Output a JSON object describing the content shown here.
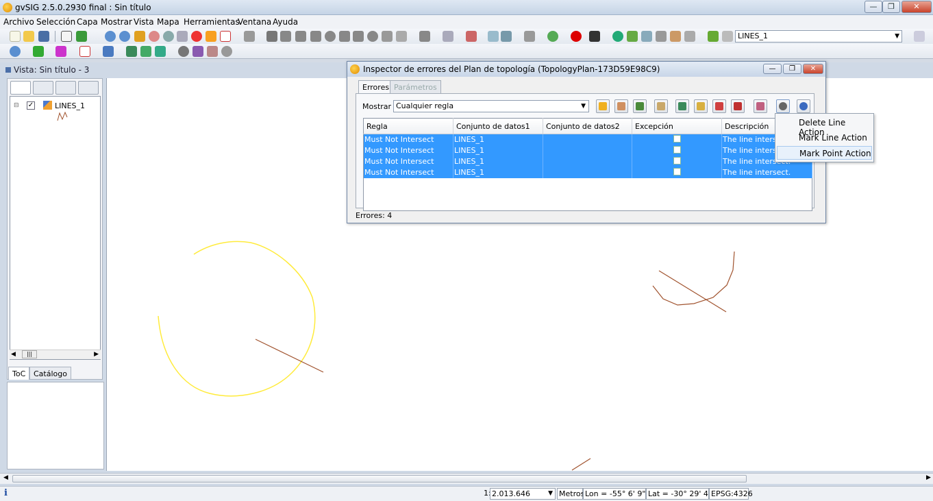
{
  "window": {
    "title": "gvSIG 2.5.0.2930 final : Sin título",
    "minimize_label": "—",
    "maximize_label": "❐",
    "close_label": "✕"
  },
  "menubar": [
    "Archivo",
    "Selección",
    "Capa",
    "Mostrar",
    "Vista",
    "Mapa",
    "Herramientas",
    "Ventana",
    "Ayuda"
  ],
  "toolbar": {
    "layer_select_value": "LINES_1"
  },
  "view": {
    "title": "Vista: Sin título - 3",
    "toc": {
      "layer_name": "LINES_1",
      "layer_checked": true,
      "tabs": [
        "ToC",
        "Catálogo"
      ],
      "scroll_thumb": "|||"
    }
  },
  "statusbar": {
    "info": "i",
    "scale_prefix": "1:",
    "scale_value": "2.013.646",
    "units": "Metros",
    "lon": "Lon = -55° 6' 9\"",
    "lat": "Lat = -30° 29' 41\"",
    "epsg": "EPSG:4326"
  },
  "dialog": {
    "title": "Inspector de errores del Plan de topología (TopologyPlan-173D59E98C9)",
    "tabs": [
      "Errores",
      "Parámetros"
    ],
    "mostrar_label": "Mostrar",
    "rule_filter": "Cualquier regla",
    "columns": [
      "Regla",
      "Conjunto de datos1",
      "Conjunto de datos2",
      "Excepción",
      "Descripción"
    ],
    "rows": [
      {
        "regla": "Must Not Intersect",
        "datos1": "LINES_1",
        "datos2": "",
        "excepcion": false,
        "descripcion": "The line intersect."
      },
      {
        "regla": "Must Not Intersect",
        "datos1": "LINES_1",
        "datos2": "",
        "excepcion": false,
        "descripcion": "The line intersect."
      },
      {
        "regla": "Must Not Intersect",
        "datos1": "LINES_1",
        "datos2": "",
        "excepcion": false,
        "descripcion": "The line intersect."
      },
      {
        "regla": "Must Not Intersect",
        "datos1": "LINES_1",
        "datos2": "",
        "excepcion": false,
        "descripcion": "The line intersect."
      }
    ],
    "errors_count": "Errores: 4"
  },
  "popup_menu": {
    "items": [
      "Delete Line Action",
      "Mark Line Action",
      "Mark Point Action"
    ],
    "active_index": 2
  },
  "colors": {
    "selection": "#3399ff",
    "circle_feature": "#ffeb3b",
    "line_feature": "#a0522d"
  }
}
